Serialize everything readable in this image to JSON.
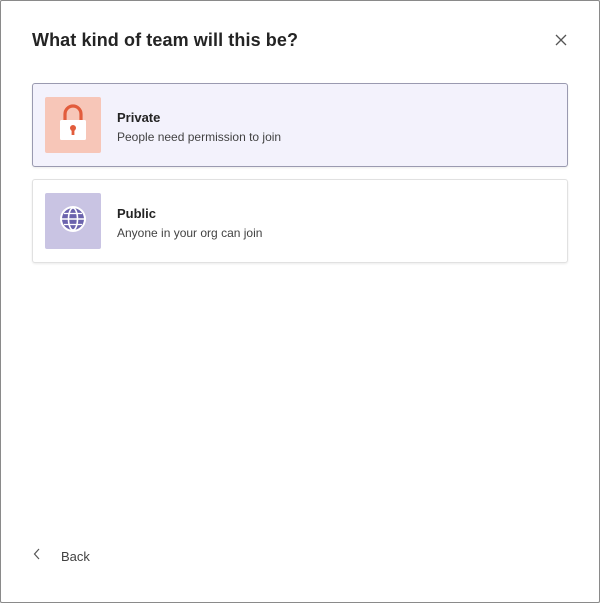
{
  "dialog": {
    "title": "What kind of team will this be?",
    "close_icon": "close-icon"
  },
  "options": [
    {
      "title": "Private",
      "subtitle": "People need permission to join",
      "icon": "lock-icon",
      "icon_bg": "#f7c6b8",
      "icon_color": "#e25c3c",
      "selected": true
    },
    {
      "title": "Public",
      "subtitle": "Anyone in your org can join",
      "icon": "globe-icon",
      "icon_bg": "#c9c4e3",
      "icon_color": "#6b63ad",
      "selected": false
    }
  ],
  "footer": {
    "back_label": "Back",
    "back_icon": "chevron-left-icon"
  },
  "colors": {
    "selected_bg": "#f3f2fc",
    "selected_border": "#9a9ab0",
    "text_primary": "#242424",
    "text_secondary": "#424242"
  }
}
